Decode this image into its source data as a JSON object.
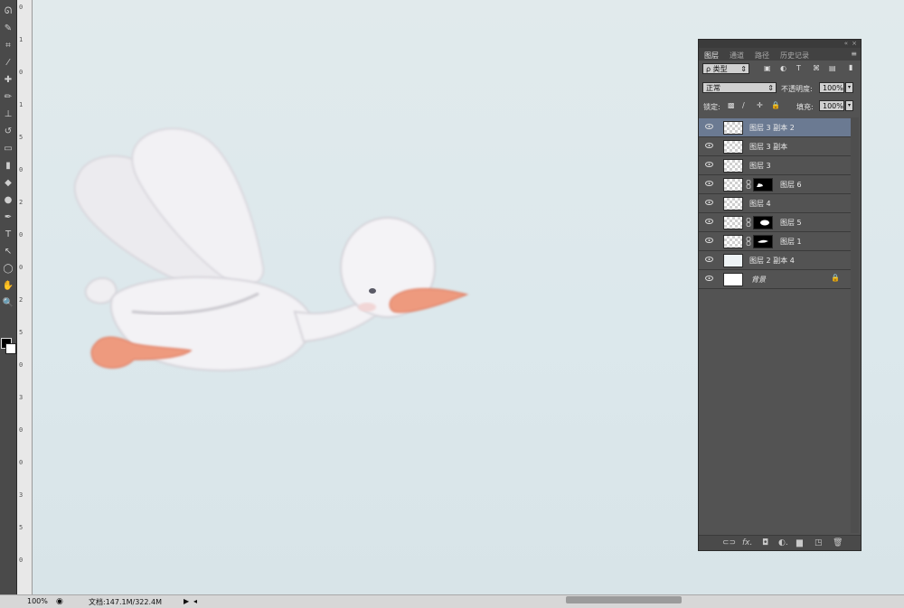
{
  "toolbar": {
    "tools": [
      {
        "icon": "lasso-icon",
        "glyph": "ᘏ"
      },
      {
        "icon": "quick-select-icon",
        "glyph": "✎"
      },
      {
        "icon": "crop-icon",
        "glyph": "⌗"
      },
      {
        "icon": "eyedropper-icon",
        "glyph": "⁄"
      },
      {
        "icon": "healing-brush-icon",
        "glyph": "✚"
      },
      {
        "icon": "brush-icon",
        "glyph": "✏"
      },
      {
        "icon": "clone-stamp-icon",
        "glyph": "⊥"
      },
      {
        "icon": "history-brush-icon",
        "glyph": "↺"
      },
      {
        "icon": "eraser-icon",
        "glyph": "▭"
      },
      {
        "icon": "gradient-icon",
        "glyph": "▮"
      },
      {
        "icon": "blur-icon",
        "glyph": "◆"
      },
      {
        "icon": "dodge-icon",
        "glyph": "●"
      },
      {
        "icon": "pen-icon",
        "glyph": "✒"
      },
      {
        "icon": "type-icon",
        "glyph": "T"
      },
      {
        "icon": "path-select-icon",
        "glyph": "↖"
      },
      {
        "icon": "ellipse-icon",
        "glyph": "◯"
      },
      {
        "icon": "hand-icon",
        "glyph": "✋"
      },
      {
        "icon": "zoom-icon",
        "glyph": "🔍"
      }
    ]
  },
  "ruler": {
    "ticks": [
      "0",
      "1",
      "0",
      "1",
      "5",
      "0",
      "2",
      "0",
      "0",
      "2",
      "5",
      "0",
      "3",
      "0",
      "0",
      "3",
      "5",
      "0"
    ]
  },
  "status": {
    "zoom": "100%",
    "doc": "文档:147.1M/322.4M"
  },
  "layers_panel": {
    "tabs": [
      "图层",
      "通道",
      "路径",
      "历史记录"
    ],
    "active_tab": "图层",
    "filter_label": "ρ 类型",
    "blend_mode": "正常",
    "opacity_label": "不透明度:",
    "opacity_value": "100%",
    "lock_label": "锁定:",
    "fill_label": "填充:",
    "fill_value": "100%",
    "layers": [
      {
        "name": "图层 3 副本 2",
        "thumb": "checker",
        "mask": false,
        "selected": true
      },
      {
        "name": "图层 3 副本",
        "thumb": "checker",
        "mask": false,
        "selected": false
      },
      {
        "name": "图层 3",
        "thumb": "checker",
        "mask": false,
        "selected": false
      },
      {
        "name": "图层 6",
        "thumb": "checker",
        "mask": true,
        "selected": false
      },
      {
        "name": "图层 4",
        "thumb": "checker",
        "mask": false,
        "selected": false
      },
      {
        "name": "图层 5",
        "thumb": "checker",
        "mask": true,
        "selected": false
      },
      {
        "name": "图层 1",
        "thumb": "checker",
        "mask": true,
        "selected": false
      },
      {
        "name": "图层 2 副本 4",
        "thumb": "plain",
        "mask": false,
        "selected": false
      },
      {
        "name": "背景",
        "thumb": "white",
        "mask": false,
        "selected": false,
        "italic": true,
        "locked": true
      }
    ],
    "footer_icons": [
      "link-layers-icon",
      "fx-icon",
      "add-mask-icon",
      "adjustment-layer-icon",
      "new-group-icon",
      "new-layer-icon",
      "delete-layer-icon"
    ],
    "footer_glyphs": [
      "⊂⊃",
      "fx.",
      "◘",
      "◐.",
      "▆",
      "◳",
      "🗑"
    ]
  },
  "colors": {
    "sky": "#dce8ec",
    "goose_white": "#f2f1f4",
    "beak": "#ee9a7e",
    "selection": "#6b7a92"
  }
}
